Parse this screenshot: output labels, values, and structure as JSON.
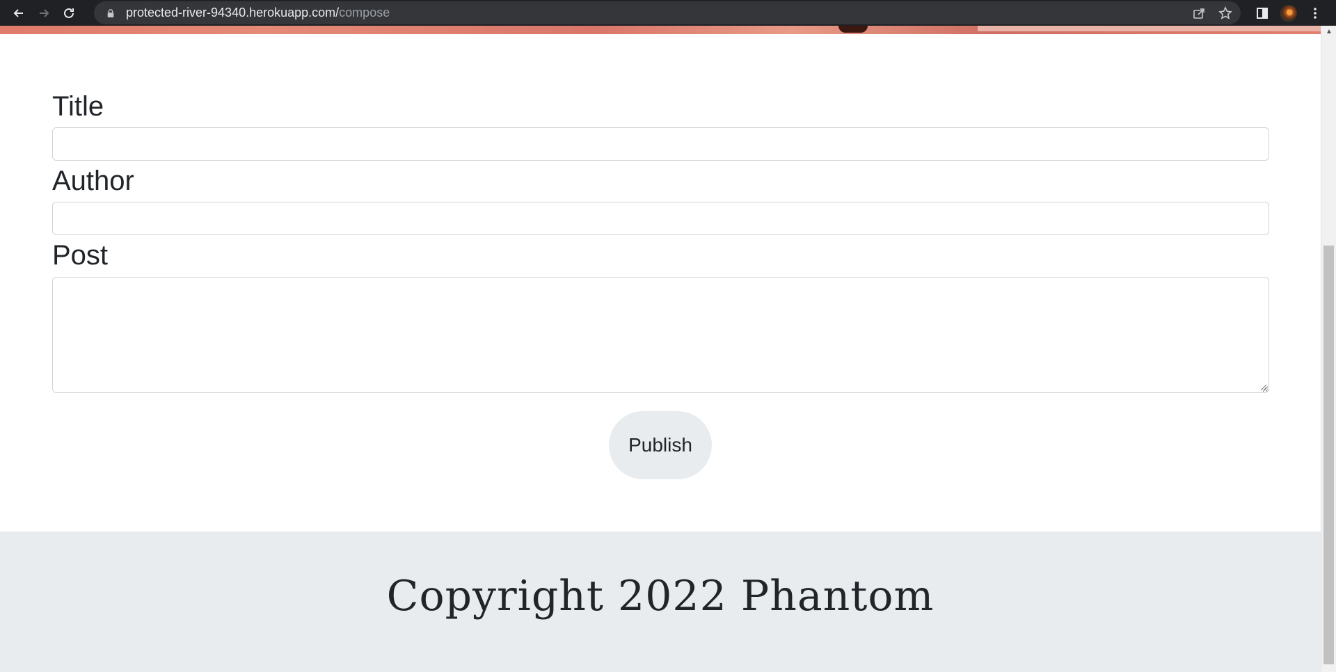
{
  "browser": {
    "url_host": "protected-river-94340.herokuapp.com/",
    "url_path": "compose",
    "icons": {
      "back": "arrow-left-icon",
      "forward": "arrow-right-icon",
      "reload": "reload-icon",
      "lock": "lock-icon",
      "share": "share-icon",
      "bookmark": "star-icon",
      "side_panel": "side-panel-icon",
      "profile": "avatar",
      "menu": "kebab-menu-icon"
    }
  },
  "form": {
    "title_label": "Title",
    "title_value": "",
    "author_label": "Author",
    "author_value": "",
    "post_label": "Post",
    "post_value": "",
    "publish_label": "Publish"
  },
  "footer": {
    "text": "Copyright 2022 Phantom"
  },
  "colors": {
    "chrome_bg": "#202124",
    "omnibox_bg": "#35363a",
    "footer_bg": "#e9ecef",
    "button_bg": "#e9ecef",
    "hero_strip": "#df7b6a"
  }
}
